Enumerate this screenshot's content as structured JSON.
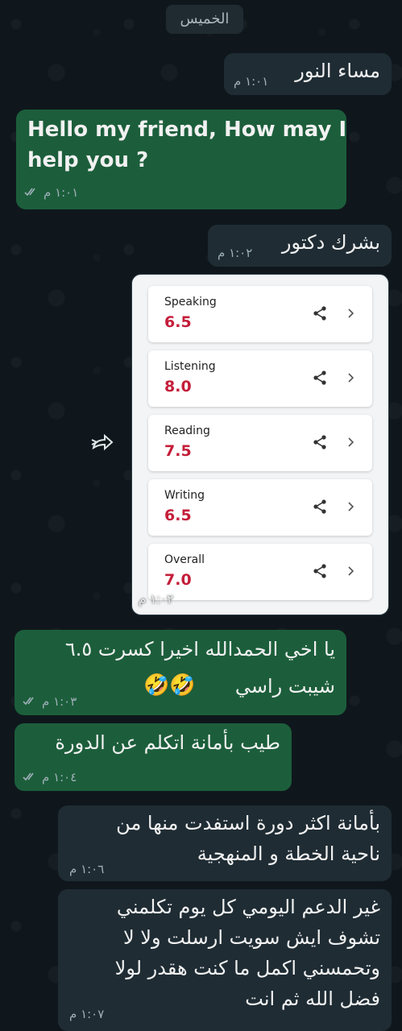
{
  "day_label": "الخميس",
  "messages": [
    {
      "text": "مساء النور",
      "time": "١:٠١ م"
    },
    {
      "line1": "Hello my friend, How may I",
      "line2": "help you ?",
      "time": "١:٠١ م"
    },
    {
      "text": "بشرك دكتور",
      "time": "١:٠٢ م"
    },
    {
      "time": "١:٠٢ م"
    },
    {
      "line1": "يا اخي الحمدالله اخيرا كسرت ٦.٥",
      "line2": "شيبت راسي",
      "emoji": "🤣🤣",
      "time": "١:٠٣ م"
    },
    {
      "text": "طيب بأمانة اتكلم عن الدورة",
      "time": "١:٠٤ م"
    },
    {
      "line1": "بأمانة اكثر دورة استفدت منها من",
      "line2": "ناحية الخطة و المنهجية",
      "time": "١:٠٦ م"
    },
    {
      "line1": "غير الدعم اليومي كل يوم تكلمني",
      "line2": "تشوف ايش سويت ارسلت ولا لا",
      "line3": "وتحمسني اكمل ما كنت هقدر لولا",
      "line4": "فضل الله ثم انت",
      "time": "١:٠٧ م"
    }
  ],
  "scores": [
    {
      "label": "Speaking",
      "value": "6.5"
    },
    {
      "label": "Listening",
      "value": "8.0"
    },
    {
      "label": "Reading",
      "value": "7.5"
    },
    {
      "label": "Writing",
      "value": "6.5"
    },
    {
      "label": "Overall",
      "value": "7.0"
    }
  ],
  "colors": {
    "incoming_bubble": "#1f2c34",
    "outgoing_bubble": "#005c4b",
    "score_value": "#c41e3a",
    "background": "#0b141a"
  },
  "icons": [
    "double-check-icon",
    "share-icon",
    "chevron-right-icon",
    "forward-icon"
  ]
}
